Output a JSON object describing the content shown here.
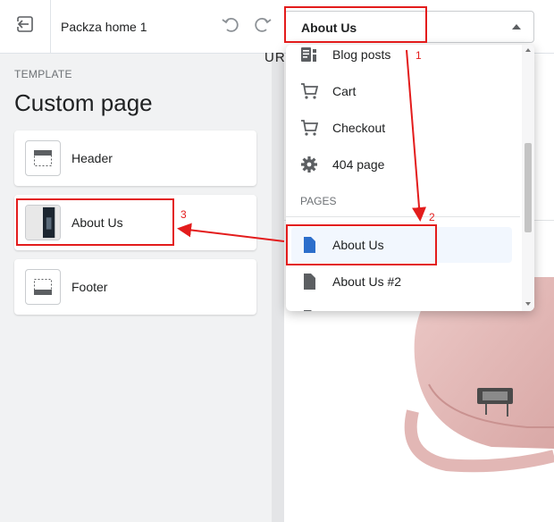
{
  "topbar": {
    "theme_name": "Packza home 1",
    "exit_icon": "exit-icon",
    "undo_icon": "undo-icon",
    "redo_icon": "redo-icon",
    "page_select_value": "About Us"
  },
  "sidebar": {
    "template_label": "TEMPLATE",
    "template_title": "Custom page",
    "sections": [
      {
        "label": "Header",
        "icon": "header-layout-icon"
      },
      {
        "label": "About Us",
        "icon": "image-thumbnail"
      },
      {
        "label": "Footer",
        "icon": "footer-layout-icon"
      }
    ]
  },
  "preview": {
    "heading_fragment": "URE"
  },
  "dropdown": {
    "items": [
      {
        "label": "Blog posts",
        "icon": "blog-icon"
      },
      {
        "label": "Cart",
        "icon": "cart-icon"
      },
      {
        "label": "Checkout",
        "icon": "cart-icon"
      },
      {
        "label": "404 page",
        "icon": "gear-icon"
      }
    ],
    "pages_group_label": "PAGES",
    "pages": [
      {
        "label": "About Us",
        "icon": "page-icon",
        "selected": true
      },
      {
        "label": "About Us #2",
        "icon": "page-icon",
        "selected": false
      }
    ]
  },
  "annotations": {
    "step1": "1",
    "step2": "2",
    "step3": "3",
    "color": "#e31c1c"
  },
  "colors": {
    "accent": "#2c6ecb",
    "selected_bg": "#f2f7fe",
    "annotation": "#e31c1c"
  }
}
